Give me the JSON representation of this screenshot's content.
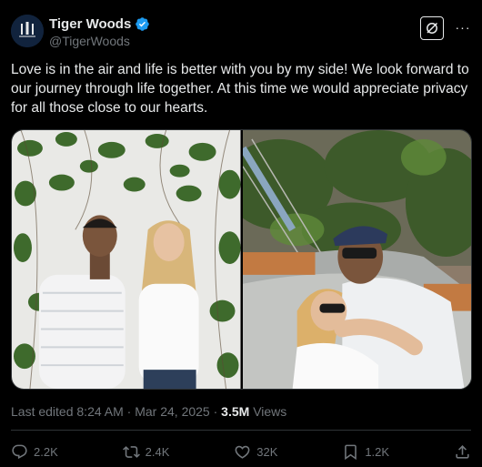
{
  "author": {
    "display_name": "Tiger Woods",
    "handle": "@TigerWoods",
    "verified_icon": "verified-badge-icon",
    "avatar_text": "TGR"
  },
  "header": {
    "grok_icon": "grok-icon",
    "more_icon": "more-icon",
    "more_label": "···"
  },
  "tweet": {
    "text": "Love is in the air and life is better with you by my side! We look forward to our journey through life together. At this time we would appreciate privacy for all those close to our hearts."
  },
  "media": {
    "photos": [
      {
        "icon": "photo-couple-standing"
      },
      {
        "icon": "photo-couple-hammock"
      }
    ]
  },
  "meta": {
    "edited_label": "Last edited",
    "time": "8:24 AM",
    "separator": "·",
    "date": "Mar 24, 2025",
    "views_count": "3.5M",
    "views_label": "Views"
  },
  "actions": {
    "replies": "2.2K",
    "reposts": "2.4K",
    "likes": "32K",
    "bookmarks": "1.2K"
  },
  "colors": {
    "background": "#000000",
    "text_primary": "#e7e9ea",
    "text_secondary": "#71767b",
    "verified": "#1d9bf0",
    "divider": "#2f3336"
  }
}
